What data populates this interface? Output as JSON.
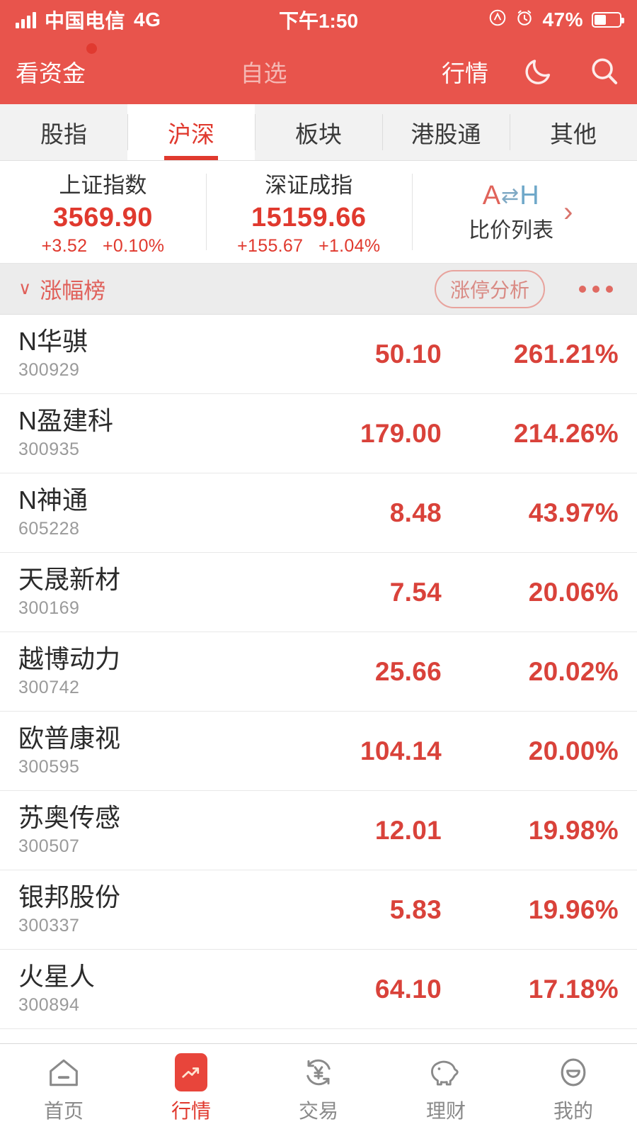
{
  "statusbar": {
    "carrier": "中国电信",
    "network": "4G",
    "time": "下午1:50",
    "battery_percent": "47%",
    "icons": [
      "signal-bars-icon",
      "location-icon",
      "alarm-icon",
      "battery-icon"
    ]
  },
  "header": {
    "funds_label": "看资金",
    "watchlist_label": "自选",
    "quotes_label": "行情",
    "night_mode_icon": "moon-icon",
    "search_icon": "search-icon"
  },
  "tabs": [
    {
      "label": "股指",
      "active": false
    },
    {
      "label": "沪深",
      "active": true
    },
    {
      "label": "板块",
      "active": false
    },
    {
      "label": "港股通",
      "active": false
    },
    {
      "label": "其他",
      "active": false
    }
  ],
  "indexes": [
    {
      "name": "上证指数",
      "value": "3569.90",
      "change": "+3.52",
      "change_pct": "+0.10%"
    },
    {
      "name": "深证成指",
      "value": "15159.66",
      "change": "+155.67",
      "change_pct": "+1.04%"
    }
  ],
  "ah_card": {
    "logo_a": "A",
    "logo_swap": "⇄",
    "logo_h": "H",
    "label": "比价列表",
    "chevron": "›"
  },
  "section": {
    "caret": "∨",
    "title": "涨幅榜",
    "pill_label": "涨停分析",
    "more_icon": "more-dots-icon"
  },
  "stocks": [
    {
      "name": "N华骐",
      "code": "300929",
      "price": "50.10",
      "change_pct": "261.21%"
    },
    {
      "name": "N盈建科",
      "code": "300935",
      "price": "179.00",
      "change_pct": "214.26%"
    },
    {
      "name": "N神通",
      "code": "605228",
      "price": "8.48",
      "change_pct": "43.97%"
    },
    {
      "name": "天晟新材",
      "code": "300169",
      "price": "7.54",
      "change_pct": "20.06%"
    },
    {
      "name": "越博动力",
      "code": "300742",
      "price": "25.66",
      "change_pct": "20.02%"
    },
    {
      "name": "欧普康视",
      "code": "300595",
      "price": "104.14",
      "change_pct": "20.00%"
    },
    {
      "name": "苏奥传感",
      "code": "300507",
      "price": "12.01",
      "change_pct": "19.98%"
    },
    {
      "name": "银邦股份",
      "code": "300337",
      "price": "5.83",
      "change_pct": "19.96%"
    },
    {
      "name": "火星人",
      "code": "300894",
      "price": "64.10",
      "change_pct": "17.18%"
    }
  ],
  "bottomnav": [
    {
      "label": "首页",
      "icon": "home-icon",
      "active": false
    },
    {
      "label": "行情",
      "icon": "quotes-icon",
      "active": true
    },
    {
      "label": "交易",
      "icon": "trade-yen-icon",
      "active": false
    },
    {
      "label": "理财",
      "icon": "piggy-bank-icon",
      "active": false
    },
    {
      "label": "我的",
      "icon": "profile-icon",
      "active": false
    }
  ],
  "colors": {
    "brand_red": "#e8544c",
    "accent_red": "#e0392e",
    "up_red": "#d9423a",
    "tab_bg": "#f2f2f2",
    "section_bg": "#ececec"
  }
}
